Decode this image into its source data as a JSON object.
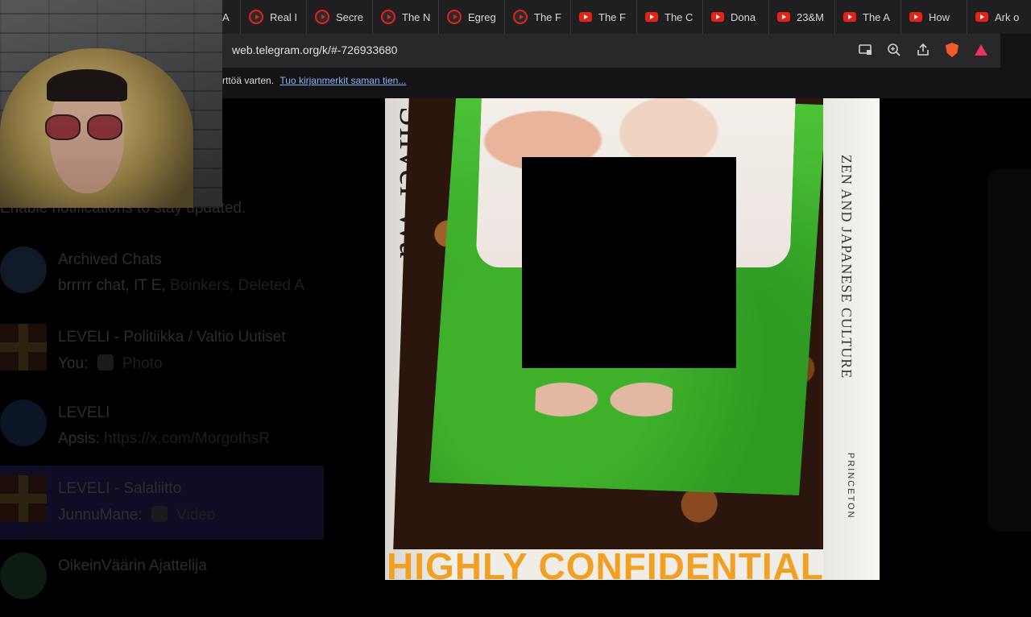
{
  "browser": {
    "tabs": [
      {
        "label": "A",
        "icon": "none"
      },
      {
        "label": "Real I",
        "icon": "youtube-ring-icon"
      },
      {
        "label": "Secre",
        "icon": "youtube-ring-icon"
      },
      {
        "label": "The N",
        "icon": "youtube-ring-icon"
      },
      {
        "label": "Egreg",
        "icon": "youtube-ring-icon"
      },
      {
        "label": "The F",
        "icon": "youtube-ring-icon"
      },
      {
        "label": "The F",
        "icon": "youtube-icon"
      },
      {
        "label": "The C",
        "icon": "youtube-icon"
      },
      {
        "label": "Dona",
        "icon": "youtube-icon"
      },
      {
        "label": "23&M",
        "icon": "youtube-icon"
      },
      {
        "label": "The A",
        "icon": "youtube-icon"
      },
      {
        "label": "How",
        "icon": "youtube-icon"
      },
      {
        "label": "Ark o",
        "icon": "youtube-icon"
      }
    ],
    "url": "web.telegram.org/k/#-726933680",
    "bookmarks_text": "rttöä varten.",
    "bookmarks_link": "Tuo kirjanmerkit saman tien..."
  },
  "telegram": {
    "notification_text": "Enable notifications to stay updated.",
    "chats": [
      {
        "title": "Archived Chats",
        "sender": "brrrrr chat, IT E,",
        "preview": "Boinkers, Deleted A"
      },
      {
        "title": "LEVELI - Politiikka / Valtio Uutiset",
        "sender": "You:",
        "preview": "Photo"
      },
      {
        "title": "LEVELI",
        "sender": "Apsis:",
        "preview": "https://x.com/MorgothsR"
      },
      {
        "title": "LEVELI - Salaliitto",
        "sender": "JunnuMane:",
        "preview": "Video"
      },
      {
        "title": "OikeinVäärin Ajattelija",
        "sender": "",
        "preview": ""
      }
    ]
  },
  "media": {
    "spine_left": "Silver Wa",
    "spine_right": "ZEN AND JAPANESE CULTURE",
    "publisher": "PRINCETON",
    "caption": "HIGHLY CONFIDENTIAL"
  },
  "colors": {
    "accent_caption": "#f2a024",
    "youtube_red": "#e62117",
    "brave_orange": "#f25a2a"
  }
}
